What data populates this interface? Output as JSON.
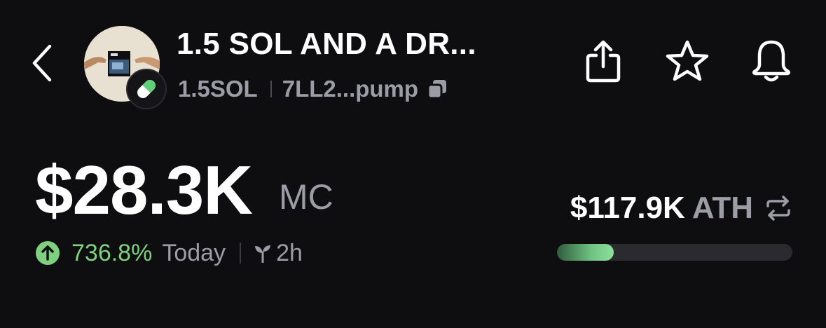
{
  "header": {
    "title": "1.5 SOL AND A DR...",
    "symbol": "1.5SOL",
    "address": "7LL2...pump",
    "icons": {
      "back": "chevron-left-icon",
      "badge": "pill-icon",
      "copy": "copy-icon",
      "share": "share-icon",
      "favorite": "star-icon",
      "alerts": "bell-icon"
    }
  },
  "market": {
    "value": "$28.3K",
    "label": "MC",
    "change_pct": "736.8%",
    "period": "Today",
    "age": "2h",
    "change_direction": "up"
  },
  "ath": {
    "value": "$117.9K",
    "label": "ATH",
    "progress_fraction": 0.24
  },
  "colors": {
    "background": "#0e0e11",
    "positive": "#7ed07f",
    "muted": "#9c9ca6",
    "bar_track": "#2a2a2f"
  }
}
